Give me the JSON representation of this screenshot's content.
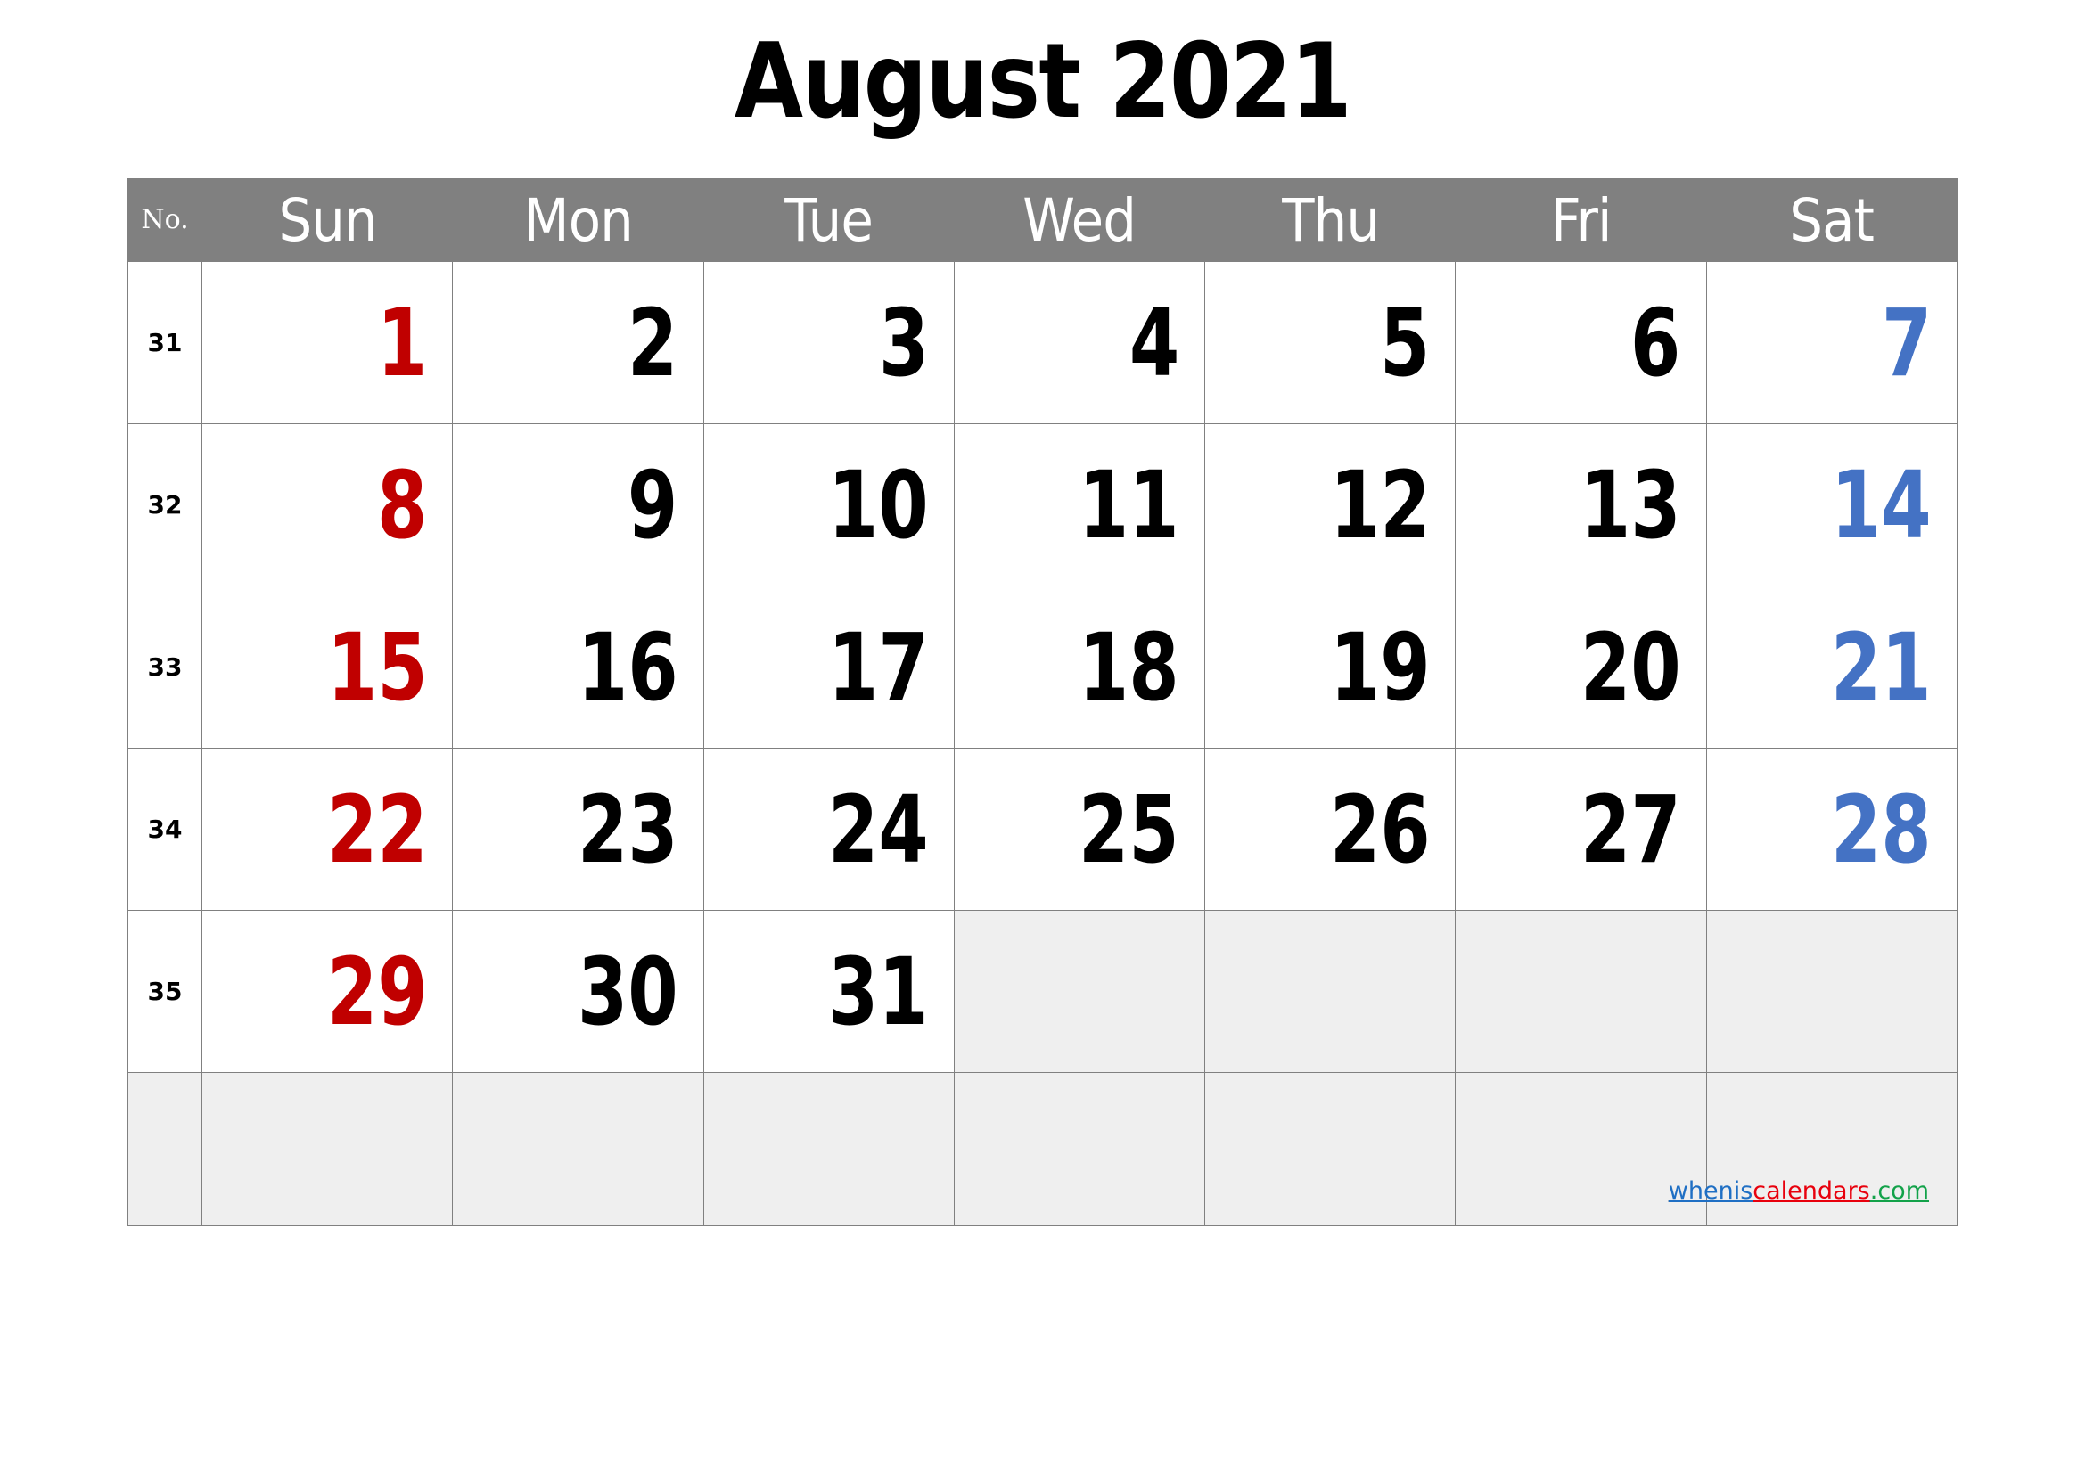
{
  "title": "August 2021",
  "header": {
    "week_no_label": "No.",
    "days": [
      "Sun",
      "Mon",
      "Tue",
      "Wed",
      "Thu",
      "Fri",
      "Sat"
    ]
  },
  "colors": {
    "header_background": "#808080",
    "header_text": "#ffffff",
    "sunday": "#c00000",
    "saturday": "#4472c4",
    "weekday": "#000000",
    "blank_cell": "#efefef",
    "grid_line": "#808080"
  },
  "weeks": [
    {
      "no": "31",
      "days": [
        {
          "num": "1",
          "kind": "sun"
        },
        {
          "num": "2",
          "kind": "wk"
        },
        {
          "num": "3",
          "kind": "wk"
        },
        {
          "num": "4",
          "kind": "wk"
        },
        {
          "num": "5",
          "kind": "wk"
        },
        {
          "num": "6",
          "kind": "wk"
        },
        {
          "num": "7",
          "kind": "sat"
        }
      ]
    },
    {
      "no": "32",
      "days": [
        {
          "num": "8",
          "kind": "sun"
        },
        {
          "num": "9",
          "kind": "wk"
        },
        {
          "num": "10",
          "kind": "wk"
        },
        {
          "num": "11",
          "kind": "wk"
        },
        {
          "num": "12",
          "kind": "wk"
        },
        {
          "num": "13",
          "kind": "wk"
        },
        {
          "num": "14",
          "kind": "sat"
        }
      ]
    },
    {
      "no": "33",
      "days": [
        {
          "num": "15",
          "kind": "sun"
        },
        {
          "num": "16",
          "kind": "wk"
        },
        {
          "num": "17",
          "kind": "wk"
        },
        {
          "num": "18",
          "kind": "wk"
        },
        {
          "num": "19",
          "kind": "wk"
        },
        {
          "num": "20",
          "kind": "wk"
        },
        {
          "num": "21",
          "kind": "sat"
        }
      ]
    },
    {
      "no": "34",
      "days": [
        {
          "num": "22",
          "kind": "sun"
        },
        {
          "num": "23",
          "kind": "wk"
        },
        {
          "num": "24",
          "kind": "wk"
        },
        {
          "num": "25",
          "kind": "wk"
        },
        {
          "num": "26",
          "kind": "wk"
        },
        {
          "num": "27",
          "kind": "wk"
        },
        {
          "num": "28",
          "kind": "sat"
        }
      ]
    },
    {
      "no": "35",
      "days": [
        {
          "num": "29",
          "kind": "sun"
        },
        {
          "num": "30",
          "kind": "wk"
        },
        {
          "num": "31",
          "kind": "wk"
        },
        {
          "num": "",
          "kind": "blank"
        },
        {
          "num": "",
          "kind": "blank"
        },
        {
          "num": "",
          "kind": "blank"
        },
        {
          "num": "",
          "kind": "blank"
        }
      ]
    },
    {
      "no": "",
      "trailing": true,
      "days": [
        {
          "num": "",
          "kind": "blank"
        },
        {
          "num": "",
          "kind": "blank"
        },
        {
          "num": "",
          "kind": "blank"
        },
        {
          "num": "",
          "kind": "blank"
        },
        {
          "num": "",
          "kind": "blank"
        },
        {
          "num": "",
          "kind": "blank"
        },
        {
          "num": "",
          "kind": "blank"
        }
      ]
    }
  ],
  "watermark": {
    "part1": "whenis",
    "part2": "calendars",
    "part3": ".com"
  }
}
